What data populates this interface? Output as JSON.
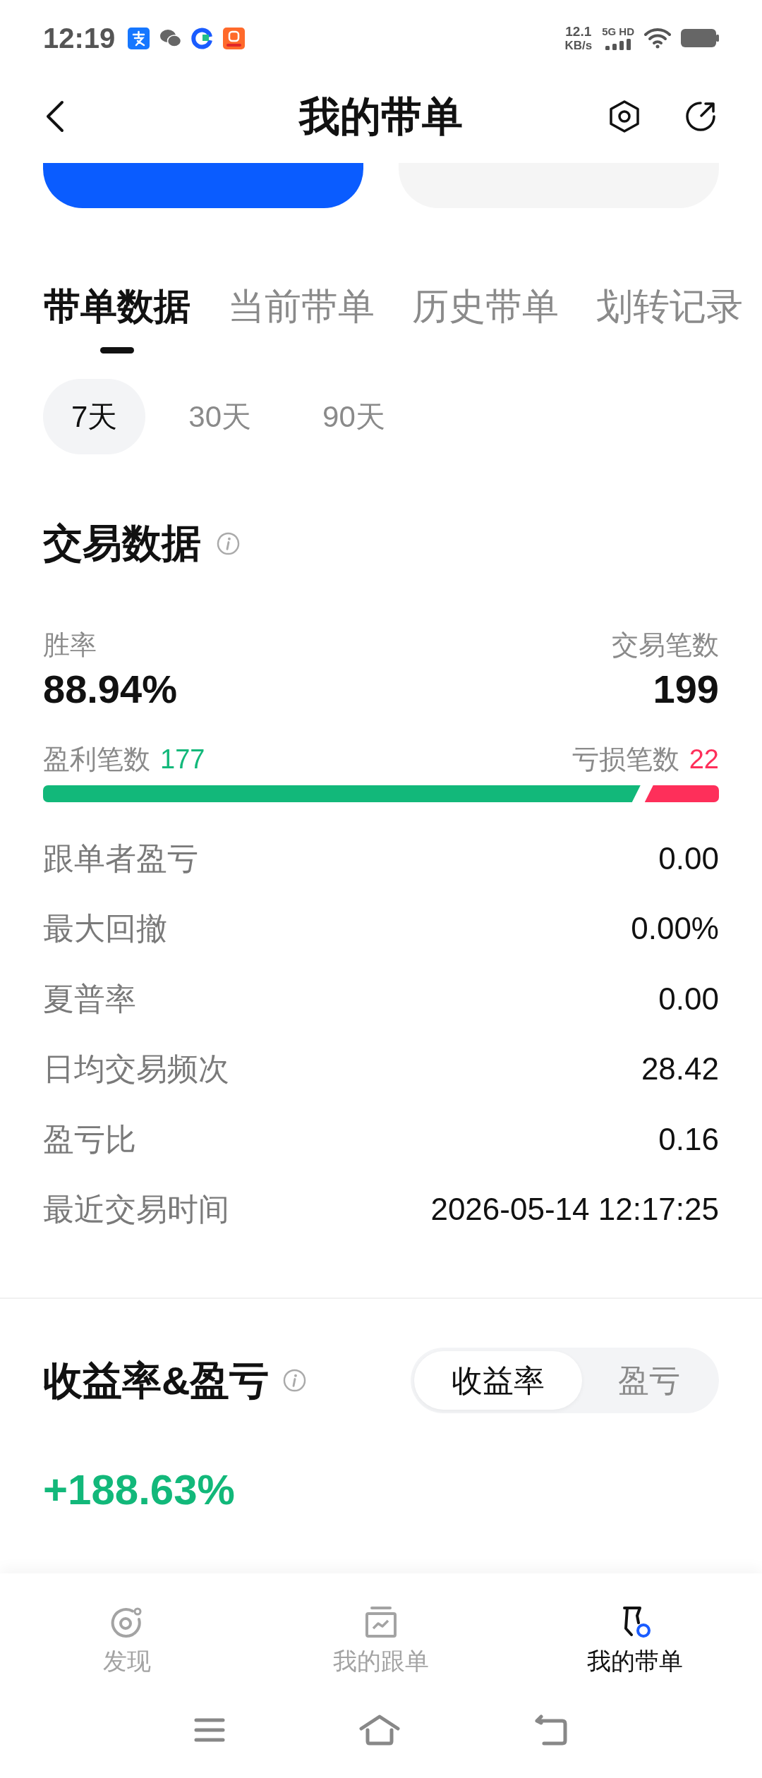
{
  "status_bar": {
    "time": "12:19",
    "net_speed": "12.1",
    "net_speed_unit": "KB/s",
    "network": "5G HD"
  },
  "header": {
    "title": "我的带单"
  },
  "action_buttons": [
    {
      "kind": "primary"
    },
    {
      "kind": "secondary"
    }
  ],
  "tabs": [
    {
      "label": "带单数据",
      "selected": true
    },
    {
      "label": "当前带单",
      "selected": false
    },
    {
      "label": "历史带单",
      "selected": false
    },
    {
      "label": "划转记录",
      "selected": false
    }
  ],
  "periods": [
    {
      "label": "7天",
      "selected": true
    },
    {
      "label": "30天",
      "selected": false
    },
    {
      "label": "90天",
      "selected": false
    }
  ],
  "trade_data": {
    "title": "交易数据",
    "win_rate": {
      "label": "胜率",
      "value": "88.94%"
    },
    "trade_count": {
      "label": "交易笔数",
      "value": "199"
    },
    "profit_trades": {
      "label": "盈利笔数",
      "value": "177"
    },
    "loss_trades": {
      "label": "亏损笔数",
      "value": "22"
    },
    "rows": [
      {
        "label": "跟单者盈亏",
        "value": "0.00"
      },
      {
        "label": "最大回撤",
        "value": "0.00%"
      },
      {
        "label": "夏普率",
        "value": "0.00"
      },
      {
        "label": "日均交易频次",
        "value": "28.42"
      },
      {
        "label": "盈亏比",
        "value": "0.16"
      },
      {
        "label": "最近交易时间",
        "value": "2026-05-14 12:17:25"
      }
    ]
  },
  "returns": {
    "title": "收益率&盈亏",
    "toggle": [
      {
        "label": "收益率",
        "selected": true
      },
      {
        "label": "盈亏",
        "selected": false
      }
    ],
    "value": "+188.63%"
  },
  "bottom_nav": [
    {
      "kind": "discover",
      "label": "发现",
      "selected": false
    },
    {
      "kind": "copy",
      "label": "我的跟单",
      "selected": false
    },
    {
      "kind": "lead",
      "label": "我的带单",
      "selected": true
    }
  ]
}
